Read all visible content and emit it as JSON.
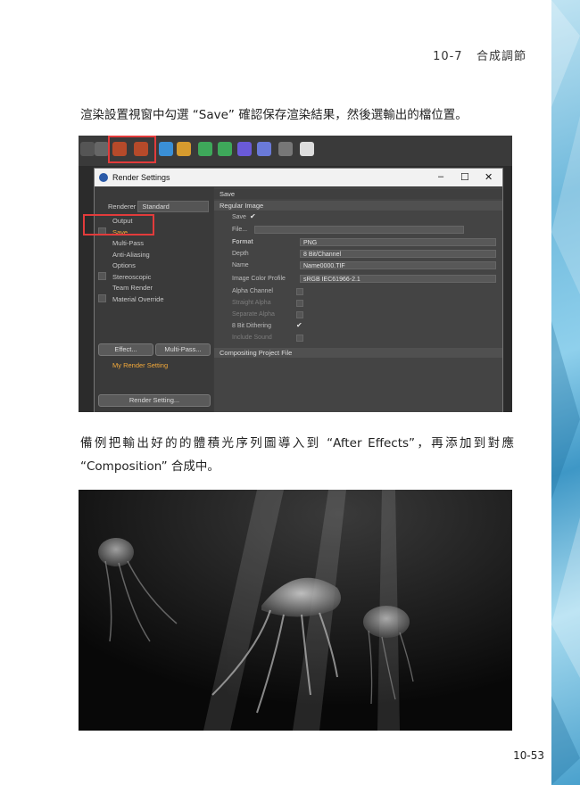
{
  "header": {
    "chapter": "10-7",
    "title": "合成調節"
  },
  "paragraphs": {
    "p1": "渲染設置視窗中勾選 “Save” 確認保存渲染結果，然後選輸出的檔位置。",
    "p2": "備例把輸出好的的體積光序列圖導入到 “After Effects”，再添加到對應 “Composition” 合成中。"
  },
  "page_number": "10-53",
  "render_settings": {
    "window_title": "Render Settings",
    "controls": {
      "minimize": "–",
      "maximize": "☐",
      "close": "✕"
    },
    "renderer_label": "Renderer",
    "renderer_value": "Standard",
    "tree": [
      "Output",
      "Save",
      "Multi-Pass",
      "Anti-Aliasing",
      "Options",
      "Stereoscopic",
      "Team Render",
      "Material Override"
    ],
    "effect_button": "Effect...",
    "multipass_button": "Multi-Pass...",
    "my_setting": "My Render Setting",
    "render_setting_button": "Render Setting...",
    "panel_title": "Save",
    "regular_image": "Regular Image",
    "save_label": "Save",
    "file_label": "File...",
    "format_label": "Format",
    "format_value": "PNG",
    "depth_label": "Depth",
    "depth_value": "8 Bit/Channel",
    "name_label": "Name",
    "name_value": "Name0000.TIF",
    "profile_label": "Image Color Profile",
    "profile_value": "sRGB IEC61966-2.1",
    "alpha_channel": "Alpha Channel",
    "straight_alpha": "Straight Alpha",
    "separate_alpha": "Separate Alpha",
    "dithering": "8 Bit Dithering",
    "include_sound": "Include Sound",
    "compositing": "Compositing Project File"
  }
}
